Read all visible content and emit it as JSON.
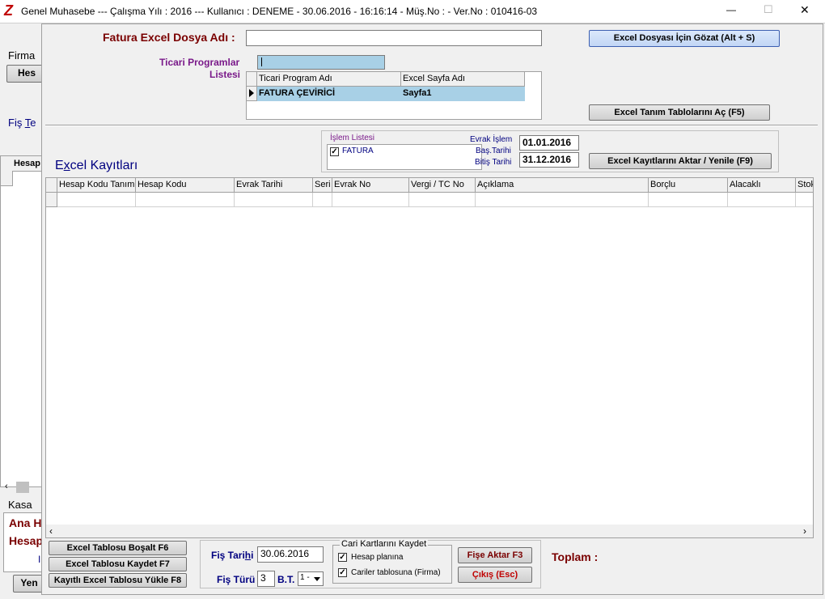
{
  "titlebar": {
    "logo": "Z",
    "title": "Genel Muhasebe  ---  Çalışma Yılı : 2016  ---  Kullanıcı : DENEME - 30.06.2016 - 16:16:14 - Müş.No :  - Ver.No : 010416-03",
    "minimize": "—",
    "maximize": "☐",
    "close": "✕"
  },
  "background": {
    "firma_label": "Firma",
    "hes_button": "Hes",
    "fis_label_prefix": "Fiş ",
    "fis_label_underlined": "T",
    "fis_label_suffix": "e",
    "hesap_col": "Hesap",
    "kasa_label": "Kasa",
    "ana_label": "Ana H",
    "hesap_label": "Hesap",
    "i_label": "I",
    "yeni_button": "Yen"
  },
  "dialog": {
    "file_label": "Fatura Excel Dosya Adı :",
    "file_value": "",
    "browse_button": "Excel Dosyası İçin Gözat (Alt + S)",
    "programs_label_line1": "Ticari Programlar",
    "programs_label_line2": "Listesi",
    "programs_search": "",
    "programs_grid": {
      "columns": [
        "Ticari Program Adı",
        "Excel Sayfa Adı"
      ],
      "rows": [
        [
          "FATURA ÇEVİRİCİ",
          "Sayfa1"
        ]
      ]
    },
    "tanim_button": "Excel Tanım Tablolarını Aç (F5)",
    "islem_listesi": {
      "title": "İşlem Listesi",
      "items": [
        {
          "label": "FATURA",
          "checked": true
        }
      ]
    },
    "evrak_label_line1": "Evrak İşlem",
    "evrak_label_line2": "Baş.Tarihi",
    "bitis_label": "Bitiş Tarihi",
    "bas_tarihi": "01.01.2016",
    "bitis_tarihi": "31.12.2016",
    "aktar_button": "Excel Kayıtlarını Aktar / Yenile (F9)",
    "kayitlar_title_prefix": "E",
    "kayitlar_title_underlined": "x",
    "kayitlar_title_suffix": "cel Kayıtları",
    "records_grid": {
      "columns": [
        "Hesap Kodu Tanımı",
        "Hesap Kodu",
        "Evrak Tarihi",
        "Seri",
        "Evrak No",
        "Vergi / TC No",
        "Açıklama",
        "Borçlu",
        "Alacaklı",
        "Stok"
      ]
    },
    "bosalt_button": "Excel Tablosu Boşalt F6",
    "kaydet_button": "Excel Tablosu Kaydet F7",
    "yukle_button": "Kayıtlı Excel Tablosu Yükle F8",
    "fis_tarihi_prefix": "Fiş Tari",
    "fis_tarihi_underlined": "h",
    "fis_tarihi_suffix": "i",
    "fis_tarihi_value": "30.06.2016",
    "fis_turu_label": "Fiş Türü",
    "fis_turu_value": "3",
    "bt_label": "B.T.",
    "bt_value": "1 -",
    "cari_group_title": "Cari Kartlarını Kaydet",
    "cari_options": [
      {
        "label": "Hesap planına",
        "checked": true
      },
      {
        "label": "Cariler tablosuna (Firma)",
        "checked": true
      }
    ],
    "fise_aktar_button": "Fişe Aktar F3",
    "cikis_button": "Çıkış (Esc)",
    "toplam_label": "Toplam :"
  },
  "colors": {
    "maroon": "#7a0000",
    "purple": "#7a1a8a",
    "navy": "#000080",
    "selection": "#a8d0e6"
  }
}
